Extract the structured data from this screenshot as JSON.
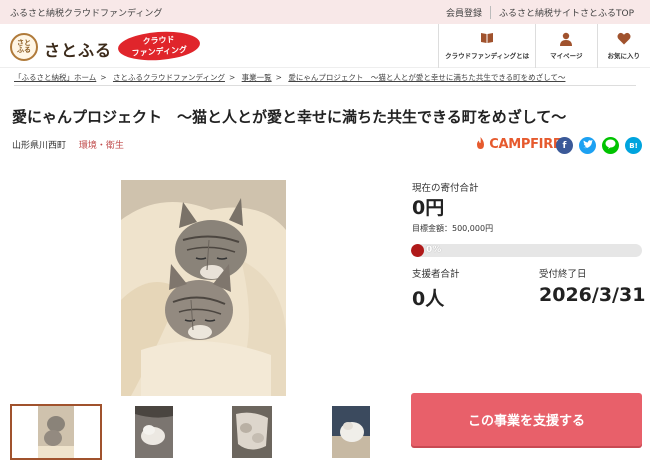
{
  "topbar": {
    "tagline": "ふるさと納税クラウドファンディング",
    "links": [
      "会員登録",
      "ふるさと納税サイトさとふるTOP"
    ]
  },
  "header": {
    "logo_mark": "さとふる",
    "logo_text": "さとふる",
    "badge_line1": "クラウド",
    "badge_line2": "ファンディング",
    "nav": [
      {
        "label": "クラウドファンディングとは",
        "icon": "book-icon"
      },
      {
        "label": "マイページ",
        "icon": "person-icon"
      },
      {
        "label": "お気に入り",
        "icon": "heart-icon"
      }
    ]
  },
  "breadcrumb": [
    "「ふるさと納税」ホーム",
    "さとふるクラウドファンディング",
    "事業一覧",
    "愛にゃんプロジェクト　～猫と人とが愛と幸せに満ちた共生できる町をめざして～"
  ],
  "project": {
    "title": "愛にゃんプロジェクト　～猫と人とが愛と幸せに満ちた共生できる町をめざして～",
    "municipality": "山形県川西町",
    "category": "環境・衛生",
    "platform": "CAMPFIRE"
  },
  "social": [
    {
      "name": "facebook",
      "glyph": "f",
      "color": "#3b5998"
    },
    {
      "name": "twitter",
      "glyph": "t",
      "color": "#1da1f2"
    },
    {
      "name": "line",
      "glyph": "L",
      "color": "#00c300"
    },
    {
      "name": "hatena",
      "glyph": "B!",
      "color": "#00a4de"
    }
  ],
  "stats": {
    "current_label": "現在の寄付合計",
    "current_value": "0円",
    "goal_text": "目標金額：500,000円",
    "progress_text": "0%",
    "progress_fraction": 0,
    "supporters_label": "支援者合計",
    "supporters_value": "0人",
    "deadline_label": "受付終了日",
    "deadline_value": "2026/3/31"
  },
  "cta": {
    "support_label": "この事業を支援する"
  },
  "colors": {
    "accent": "#e8606a",
    "brand_red": "#e0252b",
    "category": "#c04a4a",
    "topbar_bg": "#f8e8e8"
  }
}
